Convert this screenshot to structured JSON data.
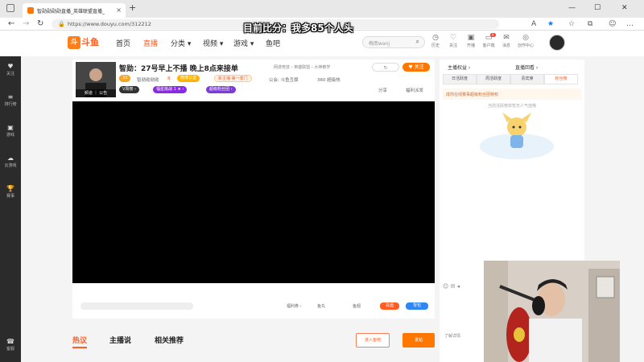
{
  "browser": {
    "tab_title": "智勋勋勋勋直播_英雄联盟直播_",
    "tab_close": "×",
    "new_tab": "+",
    "url": "https://www.douyu.com/312212",
    "win_min": "—",
    "win_max": "☐",
    "win_close": "✕"
  },
  "overlay": {
    "text": "目前比分：我多85个人头"
  },
  "header": {
    "logo_text": "斗鱼",
    "logo_badge": "斗",
    "nav": [
      "首页",
      "直播",
      "分类 ▾",
      "视频 ▾",
      "游戏 ▾",
      "鱼吧"
    ],
    "search_placeholder": "梅南wanj",
    "icons": [
      {
        "label": "历史",
        "glyph": "◷"
      },
      {
        "label": "关注",
        "glyph": "♡"
      },
      {
        "label": "开播",
        "glyph": "▣"
      },
      {
        "label": "客户端",
        "glyph": "▭"
      },
      {
        "label": "消息",
        "glyph": "✉"
      },
      {
        "label": "创作中心",
        "glyph": "◎"
      }
    ],
    "client_badge": "8"
  },
  "sidebar": {
    "items": [
      {
        "label": "关注",
        "glyph": "♥"
      },
      {
        "label": "排行榜",
        "glyph": "≡"
      },
      {
        "label": "游戏",
        "glyph": "▣"
      },
      {
        "label": "云游戏",
        "glyph": "☁"
      },
      {
        "label": "赛事",
        "glyph": "🏆"
      },
      {
        "label": "客服",
        "glyph": "☎"
      }
    ],
    "toggle": "›"
  },
  "room": {
    "title": "智勋：27号早上不播 晚上8点来接单",
    "category": "网游竞技 › 英雄联盟 › 大神教学",
    "streamer_caption": "频道 ｜ 公告",
    "level_badge": "33",
    "streamer_name": "智勋勋勋勋",
    "hot": "8",
    "tag_cert": "微博认证",
    "tag_rank": "新主播·第一季门",
    "guild": "公会: 斗鱼互娱",
    "heat": "360 超级热",
    "tag_v": "V周榜 ›",
    "tag_fans": "福星挑战 1 ★ ›",
    "tag_group": "超级粉丝团 ›",
    "follow_label": "♥ 关注",
    "share_label": "分享",
    "report_label": "福利派发"
  },
  "right_panel": {
    "top_label": "主播权益 ›",
    "top_label2": "直播回看 ›",
    "tabs": [
      "日活跃度",
      "周活跃度",
      "贵宾席",
      "粉丝榜"
    ],
    "active_tab": 3,
    "notice": "成你在线赛事超级粉丝团特权",
    "empty_text": "当前活跃榜单暂无人气值哦",
    "chat_hint": "了解详情"
  },
  "player_bar": {
    "bar_label": "福利券 ›",
    "ctl_1": "鱼丸",
    "ctl_2": "鱼翅",
    "btn_1": "充值",
    "btn_2": "背包"
  },
  "bottom": {
    "tabs": [
      "热议",
      "主播说",
      "相关推荐"
    ],
    "btn_outline": "进入鱼吧",
    "btn_fill": "发帖"
  },
  "colors": {
    "brand": "#ff5d23",
    "accent": "#ff7700",
    "purple": "#8a2be2"
  }
}
